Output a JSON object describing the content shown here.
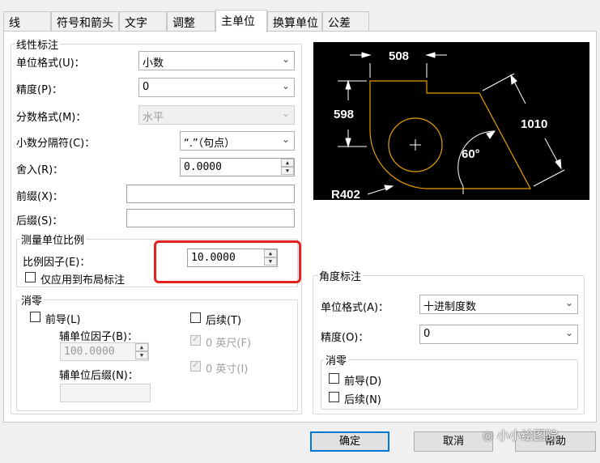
{
  "tabs": [
    "线",
    "符号和箭头",
    "文字",
    "调整",
    "主单位",
    "换算单位",
    "公差"
  ],
  "linear": {
    "title": "线性标注",
    "unit_format_label": "单位格式(U)：",
    "unit_format_value": "小数",
    "precision_label": "精度(P)：",
    "precision_value": "0",
    "fraction_format_label": "分数格式(M)：",
    "fraction_format_value": "水平",
    "decimal_sep_label": "小数分隔符(C)：",
    "decimal_sep_value": "“.”（句点）",
    "round_label": "舍入(R)：",
    "round_value": "0.0000",
    "prefix_label": "前缀(X)：",
    "prefix_value": "",
    "suffix_label": "后缀(S)：",
    "suffix_value": ""
  },
  "scale": {
    "title": "测量单位比例",
    "factor_label": "比例因子(E)：",
    "factor_value": "10.0000",
    "layout_only_label": "仅应用到布局标注"
  },
  "zero": {
    "title": "消零",
    "leading_label": "前导(L)",
    "trailing_label": "后续(T)",
    "sub_factor_label": "辅单位因子(B)：",
    "sub_factor_value": "100.0000",
    "sub_suffix_label": "辅单位后缀(N)：",
    "sub_suffix_value": "",
    "feet_label": "0 英尺(F)",
    "inches_label": "0 英寸(I)"
  },
  "angular": {
    "title": "角度标注",
    "unit_format_label": "单位格式(A)：",
    "unit_format_value": "十进制度数",
    "precision_label": "精度(O)：",
    "precision_value": "0",
    "zero_title": "消零",
    "leading_label": "前导(D)",
    "trailing_label": "后续(N)"
  },
  "preview": {
    "dim_top": "508",
    "dim_left": "598",
    "dim_right": "1010",
    "angle": "60°",
    "radius": "R402"
  },
  "buttons": {
    "ok": "确定",
    "cancel": "取消",
    "help": "帮助"
  },
  "watermark": "小小绘图院",
  "colors": {
    "highlight": "#e0231f",
    "preview_bg": "#000000",
    "preview_geometry": "#e8a000",
    "default_button_border": "#0078d7"
  }
}
